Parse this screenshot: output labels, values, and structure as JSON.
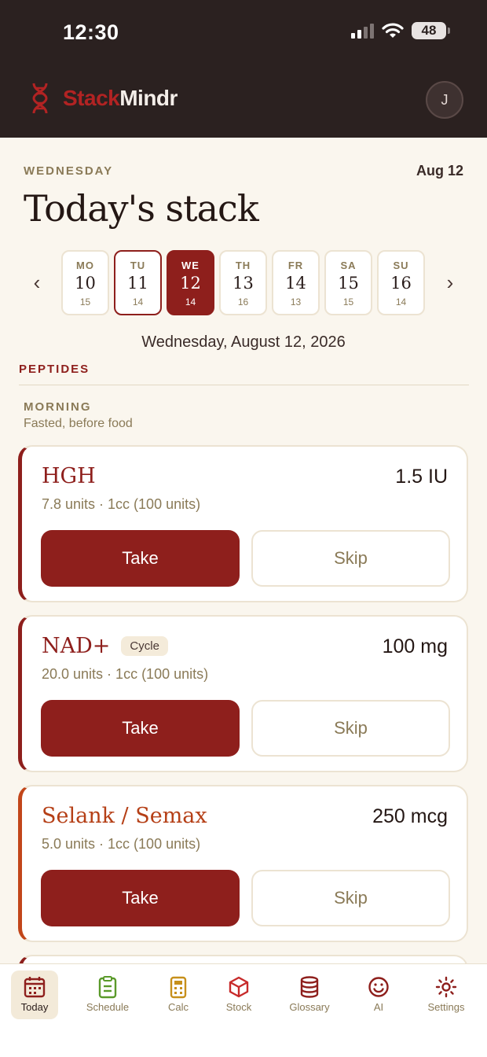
{
  "status_bar": {
    "time": "12:30",
    "battery": "48"
  },
  "header": {
    "brand_part1": "Stack",
    "brand_part2": "Mindr",
    "avatar_initial": "J"
  },
  "page": {
    "weekday": "WEDNESDAY",
    "short_date": "Aug 12",
    "title": "Today's stack",
    "full_date": "Wednesday, August 12, 2026"
  },
  "week": {
    "prev_icon": "chevron-left-icon",
    "next_icon": "chevron-right-icon",
    "days": [
      {
        "abbr": "MO",
        "num": "10",
        "count": "15"
      },
      {
        "abbr": "TU",
        "num": "11",
        "count": "14"
      },
      {
        "abbr": "WE",
        "num": "12",
        "count": "14"
      },
      {
        "abbr": "TH",
        "num": "13",
        "count": "16"
      },
      {
        "abbr": "FR",
        "num": "14",
        "count": "13"
      },
      {
        "abbr": "SA",
        "num": "15",
        "count": "15"
      },
      {
        "abbr": "SU",
        "num": "16",
        "count": "14"
      }
    ]
  },
  "section": {
    "title": "PEPTIDES",
    "slot_title": "MORNING",
    "slot_subtitle": "Fasted, before food"
  },
  "items": [
    {
      "name": "HGH",
      "badge": "",
      "dose": "1.5 IU",
      "units": "7.8 units · 1cc (100 units)",
      "take": "Take",
      "skip": "Skip",
      "accent": "#8e1f1c"
    },
    {
      "name": "NAD+",
      "badge": "Cycle",
      "dose": "100 mg",
      "units": "20.0 units · 1cc (100 units)",
      "take": "Take",
      "skip": "Skip",
      "accent": "#8e1f1c"
    },
    {
      "name": "Selank / Semax",
      "badge": "",
      "dose": "250 mcg",
      "units": "5.0 units · 1cc (100 units)",
      "take": "Take",
      "skip": "Skip",
      "accent": "#c2461a"
    }
  ],
  "tabs": [
    {
      "label": "Today",
      "icon": "calendar-icon"
    },
    {
      "label": "Schedule",
      "icon": "clipboard-icon"
    },
    {
      "label": "Calc",
      "icon": "calculator-icon"
    },
    {
      "label": "Stock",
      "icon": "box-icon"
    },
    {
      "label": "Glossary",
      "icon": "database-icon"
    },
    {
      "label": "AI",
      "icon": "smiley-icon"
    },
    {
      "label": "Settings",
      "icon": "gear-icon"
    }
  ]
}
